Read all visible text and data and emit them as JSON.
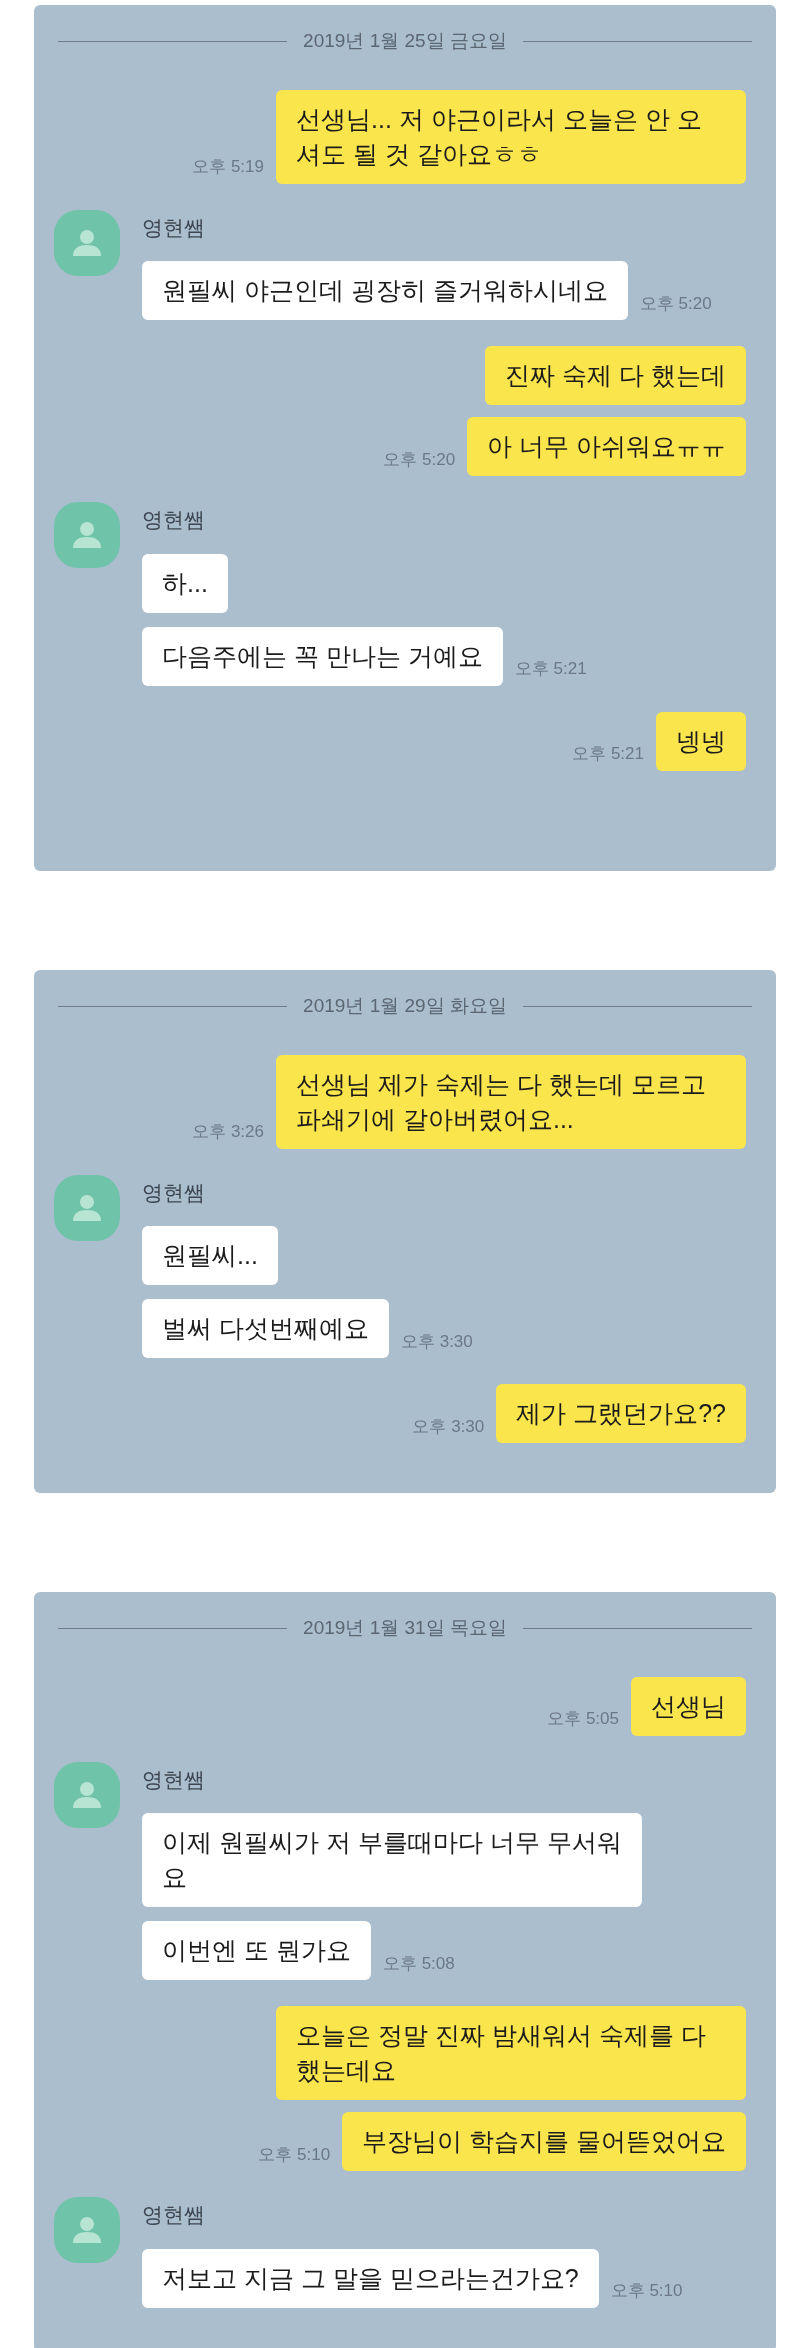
{
  "panels": [
    {
      "date": "2019년 1월 25일 금요일",
      "groups": [
        {
          "kind": "sent",
          "messages": [
            {
              "text": "선생님... 저 야근이라서 오늘은 안 오셔도 될 것 같아요ㅎㅎ",
              "time": "오후 5:19"
            }
          ]
        },
        {
          "kind": "received",
          "sender": "영현쌤",
          "messages": [
            {
              "text": "원필씨 야근인데 굉장히 즐거워하시네요",
              "time": "오후 5:20"
            }
          ]
        },
        {
          "kind": "sent",
          "messages": [
            {
              "text": "진짜 숙제 다 했는데"
            },
            {
              "text": "아 너무 아쉬워요ㅠㅠ",
              "time": "오후 5:20"
            }
          ]
        },
        {
          "kind": "received",
          "sender": "영현쌤",
          "messages": [
            {
              "text": "하..."
            },
            {
              "text": "다음주에는 꼭 만나는 거예요",
              "time": "오후 5:21"
            }
          ]
        },
        {
          "kind": "sent",
          "messages": [
            {
              "text": "넹넹",
              "time": "오후 5:21"
            }
          ]
        }
      ]
    },
    {
      "date": "2019년 1월 29일 화요일",
      "groups": [
        {
          "kind": "sent",
          "messages": [
            {
              "text": "선생님 제가 숙제는 다 했는데 모르고 파쇄기에 갈아버렸어요...",
              "time": "오후 3:26"
            }
          ]
        },
        {
          "kind": "received",
          "sender": "영현쌤",
          "messages": [
            {
              "text": "원필씨..."
            },
            {
              "text": "벌써 다섯번째예요",
              "time": "오후 3:30"
            }
          ]
        },
        {
          "kind": "sent",
          "messages": [
            {
              "text": "제가 그랬던가요??",
              "time": "오후 3:30"
            }
          ]
        }
      ]
    },
    {
      "date": "2019년 1월 31일 목요일",
      "groups": [
        {
          "kind": "sent",
          "messages": [
            {
              "text": "선생님",
              "time": "오후 5:05"
            }
          ]
        },
        {
          "kind": "received",
          "sender": "영현쌤",
          "messages": [
            {
              "text": "이제 원필씨가 저 부를때마다 너무 무서워요"
            },
            {
              "text": "이번엔 또 뭔가요",
              "time": "오후 5:08"
            }
          ]
        },
        {
          "kind": "sent",
          "messages": [
            {
              "text": "오늘은 정말 진짜 밤새워서 숙제를 다 했는데요"
            },
            {
              "text": "부장님이 학습지를 물어뜯었어요",
              "time": "오후 5:10"
            }
          ]
        },
        {
          "kind": "received",
          "sender": "영현쌤",
          "messages": [
            {
              "text": "저보고 지금 그 말을 믿으라는건가요?",
              "time": "오후 5:10"
            }
          ]
        }
      ]
    }
  ]
}
